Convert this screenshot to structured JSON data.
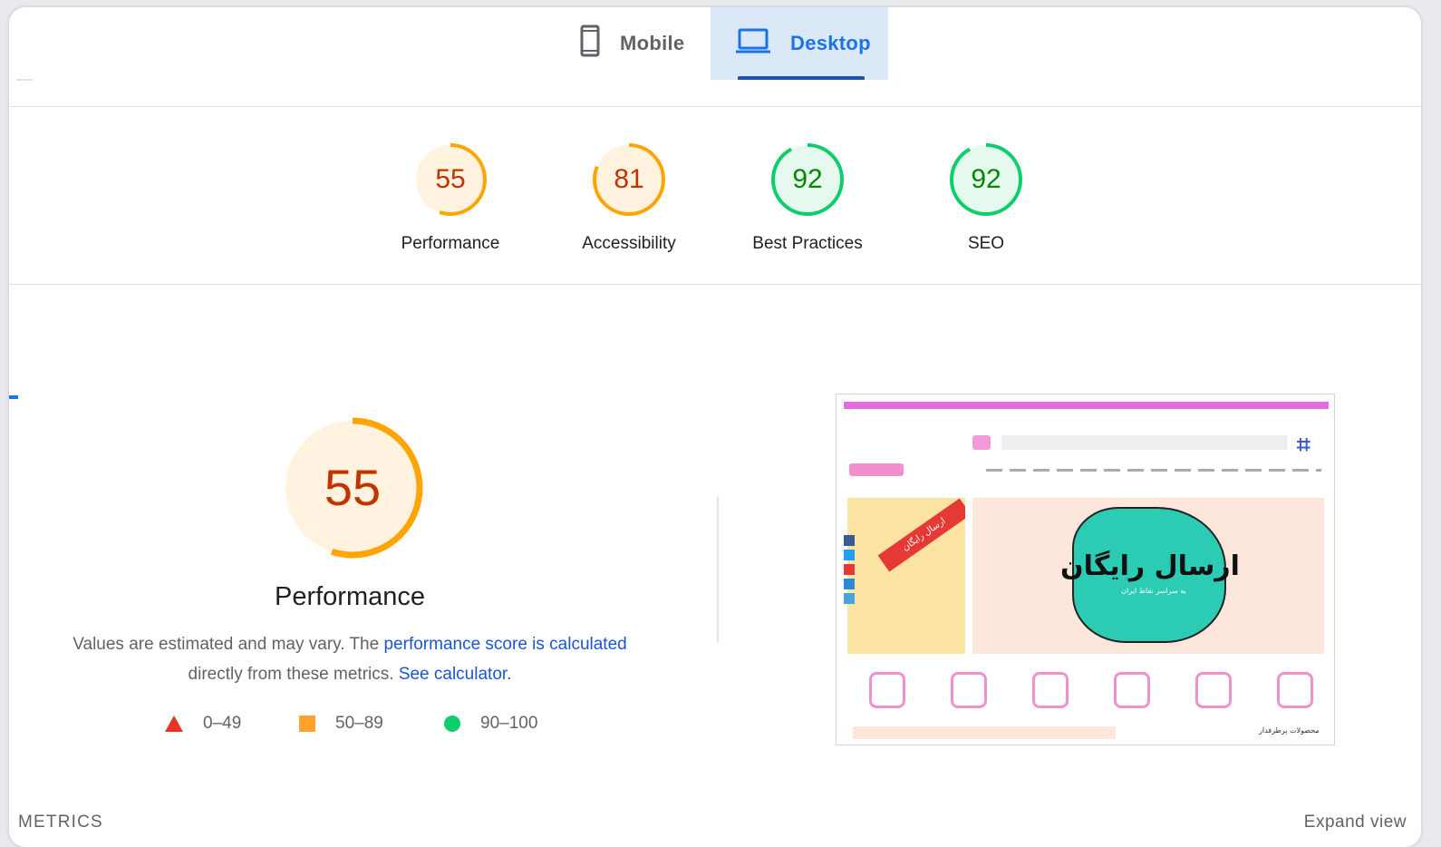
{
  "tabs": {
    "mobile": {
      "label": "Mobile",
      "icon": "smartphone-icon"
    },
    "desktop": {
      "label": "Desktop",
      "icon": "laptop-icon",
      "selected": true
    }
  },
  "scores": [
    {
      "label": "Performance",
      "value": "55",
      "color": "#ffa400",
      "text_color": "#c33300",
      "fill": "#fff3e0"
    },
    {
      "label": "Accessibility",
      "value": "81",
      "color": "#ffa400",
      "text_color": "#c33300",
      "fill": "#fff3e0"
    },
    {
      "label": "Best Practices",
      "value": "92",
      "color": "#0cce6b",
      "text_color": "#008800",
      "fill": "#e6f9ef"
    },
    {
      "label": "SEO",
      "value": "92",
      "color": "#0cce6b",
      "text_color": "#008800",
      "fill": "#e6f9ef"
    }
  ],
  "performance": {
    "score": "55",
    "title": "Performance",
    "desc_prefix": "Values are estimated and may vary. The ",
    "desc_link": "performance score is calculated",
    "desc_middle": " directly from these metrics. ",
    "calc_link": "See calculator."
  },
  "legend": [
    {
      "range": "0–49",
      "shape": "triangle",
      "color": "#eb3223"
    },
    {
      "range": "50–89",
      "shape": "square",
      "color": "#ffa32e"
    },
    {
      "range": "90–100",
      "shape": "circle",
      "color": "#0cce6b"
    }
  ],
  "thumbnail": {
    "banner_title": "ارسال رایگان",
    "banner_sub": "به سراسر نقاط ایران",
    "ribbon": "ارسال رایگان",
    "bottom_label": "محصولات پرطرفدار"
  },
  "footer": {
    "metrics_label": "METRICS",
    "expand_label": "Expand view"
  }
}
